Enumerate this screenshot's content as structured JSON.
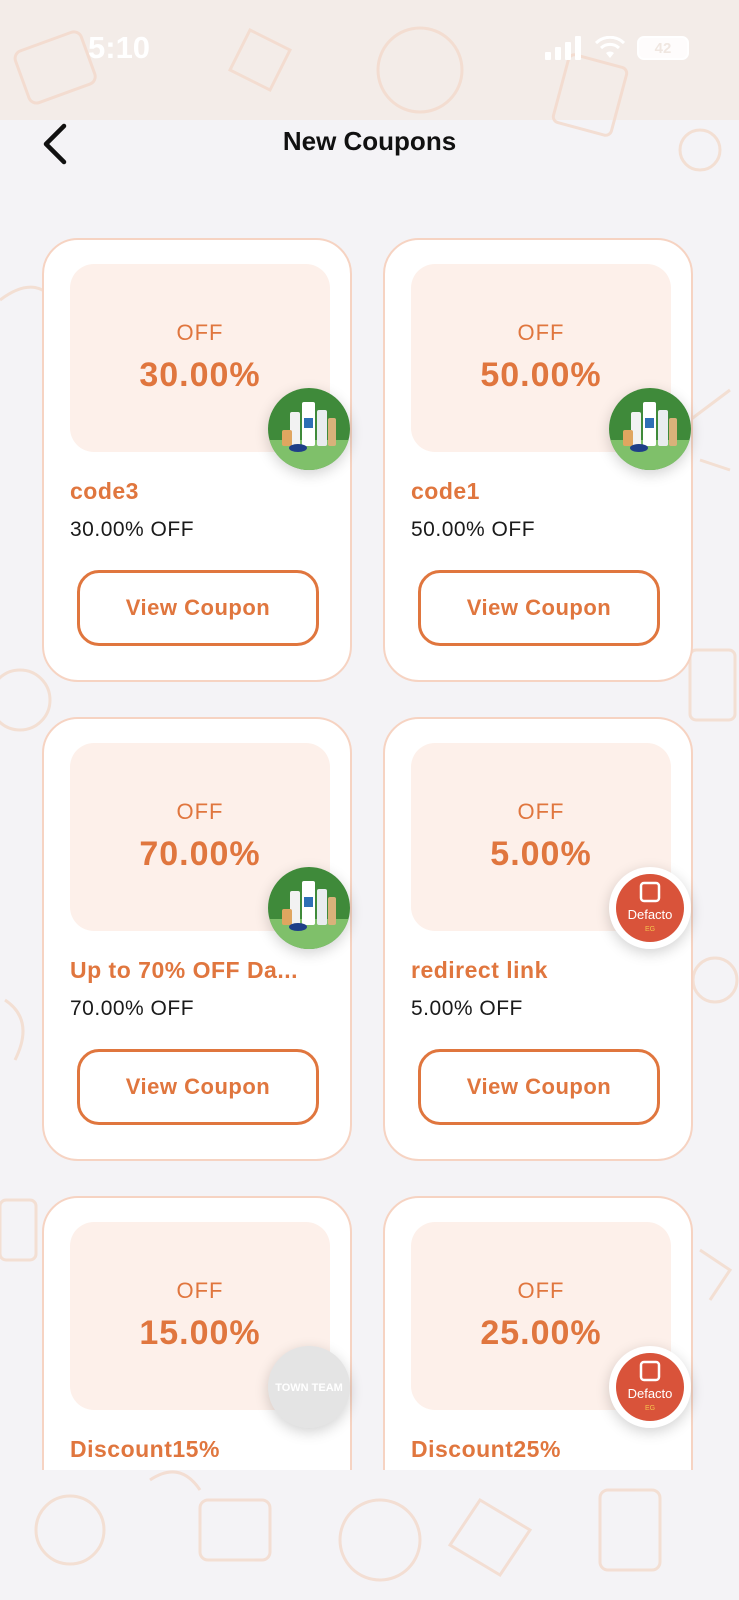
{
  "status_bar": {
    "time": "5:10",
    "battery": "42"
  },
  "header": {
    "title": "New Coupons",
    "back_icon": "chevron-left-icon"
  },
  "colors": {
    "accent": "#e0763e",
    "card_tint": "#fdf0ea",
    "card_border": "#f6d3c2"
  },
  "coupons": [
    {
      "off_label": "OFF",
      "percent": "30.00%",
      "name": "code3",
      "description": "30.00% OFF",
      "button": "View Coupon",
      "logo": "skincare-products-logo"
    },
    {
      "off_label": "OFF",
      "percent": "50.00%",
      "name": "code1",
      "description": "50.00% OFF",
      "button": "View Coupon",
      "logo": "skincare-products-logo"
    },
    {
      "off_label": "OFF",
      "percent": "70.00%",
      "name": "Up to 70% OFF Da...",
      "description": "70.00% OFF",
      "button": "View Coupon",
      "logo": "skincare-products-logo"
    },
    {
      "off_label": "OFF",
      "percent": "5.00%",
      "name": "redirect link",
      "description": "5.00% OFF",
      "button": "View Coupon",
      "logo": "defacto-logo",
      "logo_text": "Defacto",
      "logo_subtext": "EG"
    },
    {
      "off_label": "OFF",
      "percent": "15.00%",
      "name": "Discount15%",
      "description": "",
      "button": "",
      "logo": "town-team-logo",
      "logo_text": "TOWN TEAM"
    },
    {
      "off_label": "OFF",
      "percent": "25.00%",
      "name": "Discount25%",
      "description": "",
      "button": "",
      "logo": "defacto-logo",
      "logo_text": "Defacto",
      "logo_subtext": "EG"
    }
  ]
}
